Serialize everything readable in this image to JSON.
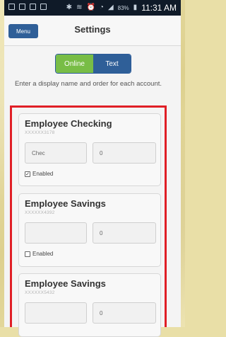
{
  "status_bar": {
    "time": "11:31 AM",
    "battery": "83%",
    "icons": [
      "notification-icon",
      "mail-icon",
      "image-icon",
      "settings-icon",
      "bluetooth-icon",
      "nfc-icon",
      "alarm-icon",
      "wifi-icon",
      "signal-icon",
      "battery-icon"
    ]
  },
  "header": {
    "menu_label": "Menu",
    "title": "Settings"
  },
  "toggle": {
    "online_label": "Online",
    "text_label": "Text",
    "selected": "Text"
  },
  "instructions": "Enter a display name and order for each account.",
  "accounts": [
    {
      "title": "Employee Checking",
      "number": "XXXXXX3178",
      "display_name": "Chec",
      "order": "0",
      "enabled_label": "Enabled",
      "enabled": true
    },
    {
      "title": "Employee Savings",
      "number": "XXXXXX4392",
      "display_name": "",
      "order": "0",
      "enabled_label": "Enabled",
      "enabled": false
    },
    {
      "title": "Employee Savings",
      "number": "XXXXXX5432",
      "display_name": "",
      "order": "0"
    }
  ],
  "colors": {
    "accent_blue": "#2f5f98",
    "accent_green": "#78bd46",
    "highlight_red": "#e01f26"
  }
}
